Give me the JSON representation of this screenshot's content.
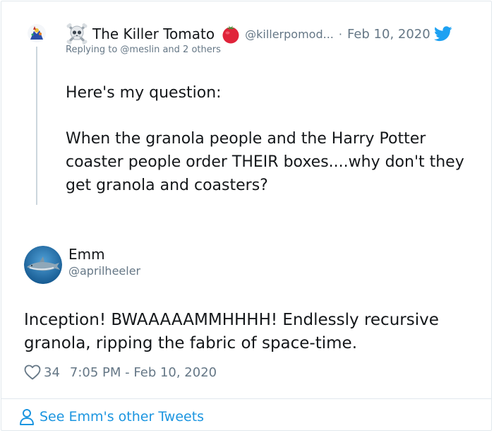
{
  "parent_tweet": {
    "avatar_icon": "wizard-avatar-icon",
    "name_prefix_icon": "skull-crossbones-icon",
    "display_name": "The Killer Tomato",
    "name_suffix_icon": "tomato-icon",
    "handle": "@killerpomod...",
    "separator": "·",
    "date": "Feb 10, 2020",
    "platform_icon": "twitter-bird-icon",
    "replying_to": "Replying to @meslin and 2 others",
    "text_line1": "Here's my question:",
    "text_line2": "When the granola people and the Harry Potter coaster people order THEIR boxes....why don't they get granola and coasters?"
  },
  "main_tweet": {
    "avatar_icon": "shark-avatar-icon",
    "display_name": "Emm",
    "handle": "@aprilheeler",
    "text": "Inception! BWAAAAAMMHHHH! Endlessly recursive granola, ripping the fabric of space-time.",
    "like_icon": "heart-icon",
    "like_count": "34",
    "timestamp": "7:05 PM - Feb 10, 2020"
  },
  "footer": {
    "icon": "person-icon",
    "link_label": "See Emm's other Tweets"
  },
  "colors": {
    "link": "#1b95e0",
    "muted": "#657786",
    "text": "#14171a",
    "border": "#e1e8ed"
  }
}
